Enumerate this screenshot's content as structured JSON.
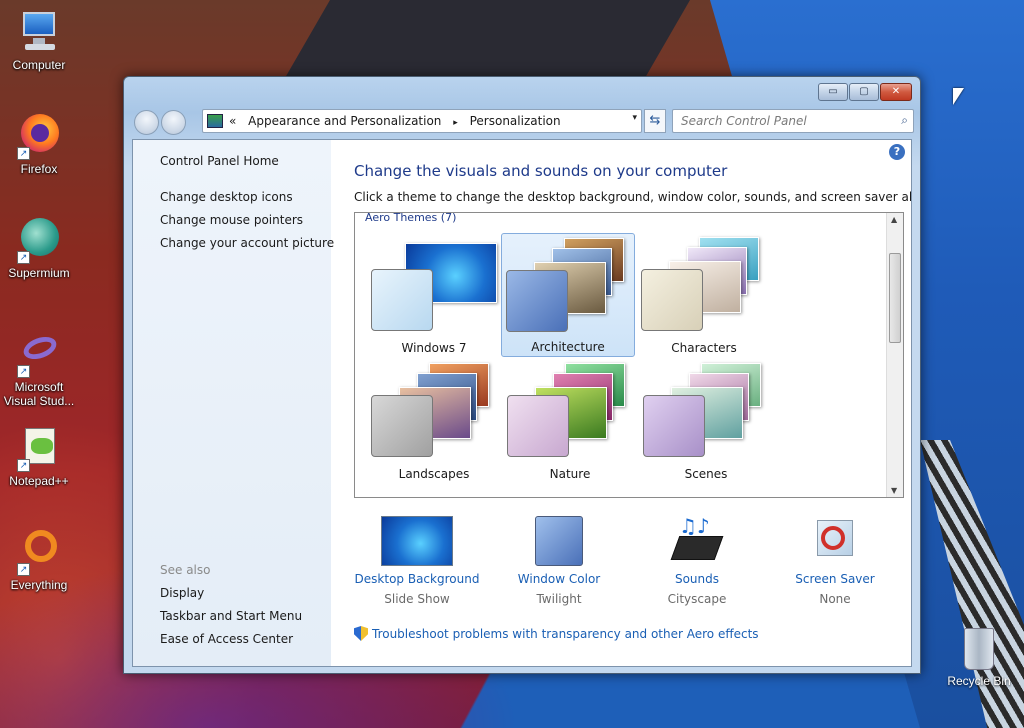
{
  "desktop": {
    "icons": [
      {
        "label": "Computer"
      },
      {
        "label": "Firefox"
      },
      {
        "label": "Supermium"
      },
      {
        "label": "Microsoft\nVisual Stud..."
      },
      {
        "label": "Notepad++"
      },
      {
        "label": "Everything"
      }
    ],
    "recycle_bin": "Recycle Bin"
  },
  "window": {
    "title_buttons": {
      "minimize": "▭",
      "maximize": "▢",
      "close": "✕"
    },
    "address": {
      "prefix": "«",
      "crumbs": [
        "Appearance and Personalization",
        "Personalization"
      ],
      "separator": "▸",
      "dropdown": "▾"
    },
    "refresh": "⇆",
    "search": {
      "placeholder": "Search Control Panel"
    }
  },
  "leftpane": {
    "home": "Control Panel Home",
    "links": [
      "Change desktop icons",
      "Change mouse pointers",
      "Change your account picture"
    ],
    "see_also_label": "See also",
    "see_also": [
      "Display",
      "Taskbar and Start Menu",
      "Ease of Access Center"
    ]
  },
  "main": {
    "help": "?",
    "heading": "Change the visuals and sounds on your computer",
    "subheading": "Click a theme to change the desktop background, window color, sounds, and screen saver all at once.",
    "group_label": "Aero Themes (7)",
    "themes": [
      {
        "name": "Windows 7",
        "selected": false
      },
      {
        "name": "Architecture",
        "selected": true
      },
      {
        "name": "Characters",
        "selected": false
      },
      {
        "name": "Landscapes",
        "selected": false
      },
      {
        "name": "Nature",
        "selected": false
      },
      {
        "name": "Scenes",
        "selected": false
      }
    ],
    "settings": [
      {
        "name": "Desktop Background",
        "value": "Slide Show"
      },
      {
        "name": "Window Color",
        "value": "Twilight"
      },
      {
        "name": "Sounds",
        "value": "Cityscape"
      },
      {
        "name": "Screen Saver",
        "value": "None"
      }
    ],
    "troubleshoot": "Troubleshoot problems with transparency and other Aero effects"
  },
  "colors": {
    "accent_link": "#1a5fb4",
    "heading": "#1e3a8a",
    "selection": "#cde3f8"
  }
}
